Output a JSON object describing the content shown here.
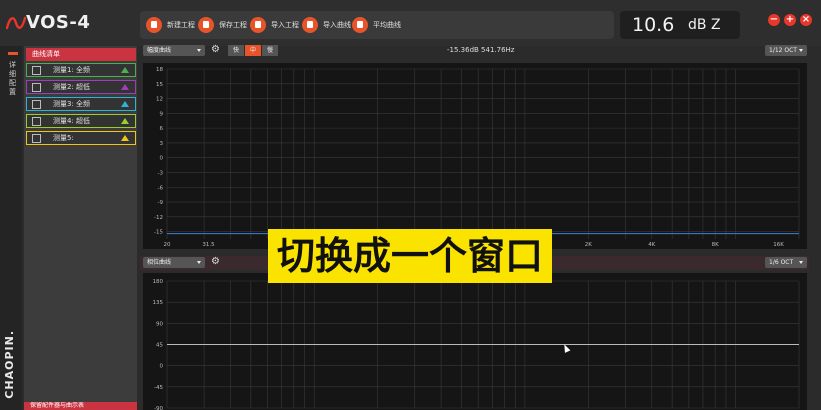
{
  "app": {
    "name": "VOS-4",
    "brand_vertical": "CHAOPIN."
  },
  "toolbar": {
    "items": [
      {
        "label": "新建工程",
        "icon": "new-project-icon"
      },
      {
        "label": "保存工程",
        "icon": "save-project-icon"
      },
      {
        "label": "导入工程",
        "icon": "import-project-icon"
      },
      {
        "label": "导入曲线",
        "icon": "import-curve-icon"
      },
      {
        "label": "平均曲线",
        "icon": "average-curve-icon"
      }
    ]
  },
  "level": {
    "value": "10.6",
    "unit": "dB Z"
  },
  "window_controls": {
    "minimize": "−",
    "maximize": "+",
    "close": "×"
  },
  "left_strip": {
    "chars": [
      "详",
      "细",
      "配",
      "置"
    ]
  },
  "curve_list": {
    "title": "曲线清单",
    "items": [
      {
        "label": "测量1: 全频",
        "color": "#4caf50"
      },
      {
        "label": "测量2: 超低",
        "color": "#9c3fb8"
      },
      {
        "label": "测量3: 全频",
        "color": "#29b6d6"
      },
      {
        "label": "测量4: 超低",
        "color": "#9acd32"
      },
      {
        "label": "测量5:",
        "color": "#f0c419"
      }
    ],
    "footer": "保留配件器与曲示表"
  },
  "magnitude": {
    "dropdown": "幅度曲线",
    "speed": [
      "快",
      "中",
      "慢"
    ],
    "speed_active": 1,
    "readout": "-15.36dB  541.76Hz",
    "resolution": "1/12 OCT"
  },
  "phase": {
    "dropdown": "相位曲线",
    "resolution": "1/6 OCT"
  },
  "caption": "切换成一个窗口",
  "colors": {
    "accent": "#e8542a",
    "panel_header": "#c93440",
    "caption_bg": "#fbe300",
    "trace": "#3f7fd6"
  },
  "chart_data": [
    {
      "type": "line",
      "x_ticks": [
        "20",
        "31.5",
        "2K",
        "4K",
        "8K",
        "16K"
      ],
      "x_tick_values": [
        20,
        31.5,
        2000,
        4000,
        8000,
        16000
      ],
      "xlim": [
        20,
        20000
      ],
      "xscale": "log",
      "y_ticks": [
        "18",
        "15",
        "12",
        "9",
        "6",
        "3",
        "0",
        "-3",
        "-6",
        "-9",
        "-12",
        "-15"
      ],
      "ylim": [
        -16.5,
        18
      ],
      "series": [
        {
          "x": [
            20,
            20000
          ],
          "y": [
            -15.4,
            -15.4
          ],
          "color": "#3f7fd6"
        }
      ],
      "grid": true
    },
    {
      "type": "line",
      "y_ticks": [
        "180",
        "135",
        "90",
        "45",
        "0",
        "-45",
        "-90"
      ],
      "ylim": [
        -90,
        180
      ],
      "xlim": [
        20,
        20000
      ],
      "xscale": "log",
      "series": [
        {
          "x": [
            20,
            20000
          ],
          "y": [
            45,
            45
          ],
          "color": "#bbbbbb"
        }
      ],
      "grid": true
    }
  ]
}
